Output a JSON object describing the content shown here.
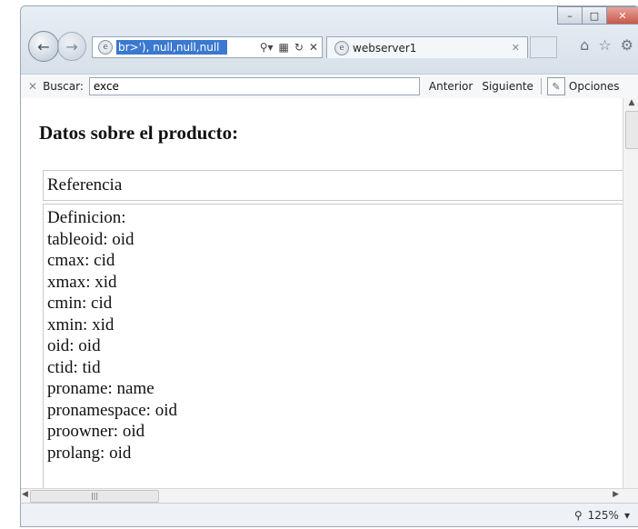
{
  "browser": {
    "address_text": "br>'), null,null,null",
    "tab_title": "webserver1",
    "icons": [
      "back-arrow-icon",
      "forward-arrow-icon",
      "search-icon",
      "compat-icon",
      "refresh-icon",
      "stop-icon",
      "home-icon",
      "star-icon",
      "gear-icon"
    ]
  },
  "findbar": {
    "label": "Buscar:",
    "value": "exce",
    "prev": "Anterior",
    "next": "Siguiente",
    "options": "Opciones"
  },
  "page": {
    "heading": "Datos sobre el producto:",
    "column_header": "Referencia",
    "lines": [
      "Definicion:",
      "tableoid: oid",
      "cmax: cid",
      "xmax: xid",
      "cmin: cid",
      "xmin: xid",
      "oid: oid",
      "ctid: tid",
      "proname: name",
      "pronamespace: oid",
      "proowner: oid",
      "prolang: oid"
    ]
  },
  "status": {
    "zoom": "125%"
  }
}
